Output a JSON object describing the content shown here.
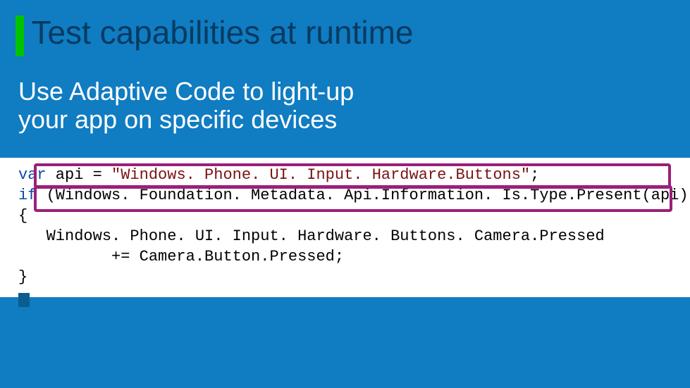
{
  "title": "Test capabilities at runtime",
  "subtitle_line1": "Use Adaptive Code to light-up",
  "subtitle_line2": "your app on specific devices",
  "code": {
    "kw_var": "var",
    "var_name": " api ",
    "eq": "= ",
    "str": "\"Windows. Phone. UI. Input. Hardware.Buttons\"",
    "semi1": ";",
    "kw_if": "if",
    "cond": " (Windows. Foundation. Metadata. Api.Information. Is.Type.Present(api))",
    "brace_open": "{",
    "body_line1": "   Windows. Phone. UI. Input. Hardware. Buttons. Camera.Pressed",
    "body_line2": "          += Camera.Button.Pressed;",
    "brace_close": "}"
  }
}
